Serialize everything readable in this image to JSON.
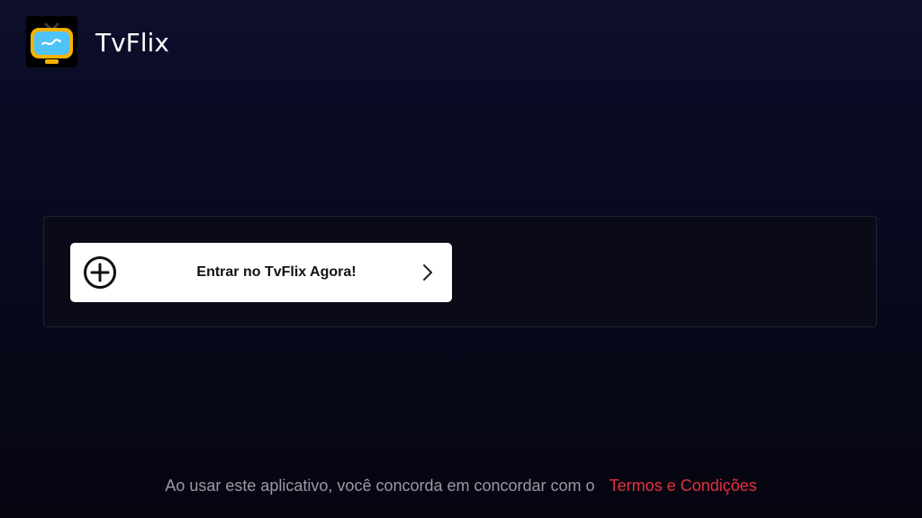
{
  "header": {
    "app_name": "TvFlix",
    "logo_icon": "tv-icon"
  },
  "main": {
    "login_button": {
      "label": "Entrar no TvFlix Agora!",
      "leading_icon": "plus-circle-icon",
      "trailing_icon": "chevron-right-icon"
    }
  },
  "footer": {
    "agreement_text": "Ao usar este aplicativo, você concorda em concordar com o",
    "terms_link": "Termos e Condições"
  },
  "colors": {
    "background": "#0a0c24",
    "accent_link": "#e8323f",
    "button_bg": "#ffffff",
    "logo_yellow": "#f5b301",
    "logo_screen": "#4fc3f7"
  }
}
